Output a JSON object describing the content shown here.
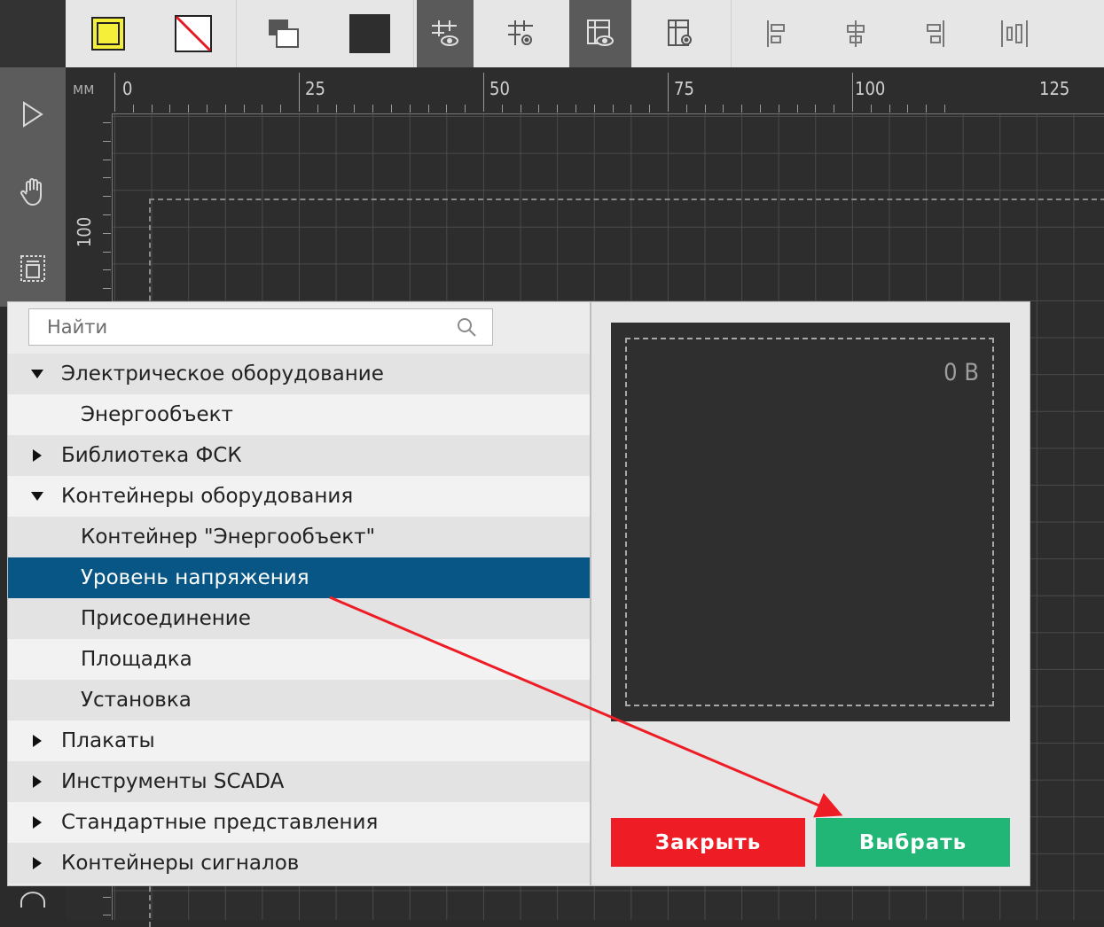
{
  "colors": {
    "accent_selected": "#075685",
    "close_button": "#ee1c25",
    "select_button": "#21b676",
    "annotation_arrow": "#ee1c25"
  },
  "toolbar": {
    "icons": [
      "yellow-frame-icon",
      "no-fill-icon",
      "bring-to-front-icon",
      "dark-fill-icon",
      "grid-visibility-icon",
      "grid-settings-icon",
      "layout-visibility-icon",
      "layout-settings-icon",
      "align-left-icon",
      "align-center-icon",
      "align-right-icon",
      "distribute-icon"
    ]
  },
  "tools": {
    "icons": [
      "pointer-icon",
      "hand-icon",
      "frame-select-icon"
    ]
  },
  "ruler": {
    "unit": "мм",
    "top_labels": [
      "0",
      "25",
      "50",
      "75",
      "100",
      "125"
    ],
    "left_label": "100"
  },
  "search": {
    "placeholder": "Найти",
    "value": ""
  },
  "tree": {
    "items": [
      {
        "label": "Электрическое оборудование",
        "expanded": true
      },
      {
        "label": "Энергообъект"
      },
      {
        "label": "Библиотека ФСК",
        "expanded": false
      },
      {
        "label": "Контейнеры оборудования",
        "expanded": true
      },
      {
        "label": "Контейнер \"Энергообъект\""
      },
      {
        "label": "Уровень напряжения",
        "selected": true
      },
      {
        "label": "Присоединение"
      },
      {
        "label": "Площадка"
      },
      {
        "label": "Установка"
      },
      {
        "label": "Плакаты",
        "expanded": false
      },
      {
        "label": "Инструменты SCADA",
        "expanded": false
      },
      {
        "label": "Стандартные представления",
        "expanded": false
      },
      {
        "label": "Контейнеры сигналов",
        "expanded": false
      }
    ]
  },
  "preview": {
    "value_text": "0 В"
  },
  "buttons": {
    "close": "Закрыть",
    "select": "Выбрать"
  }
}
